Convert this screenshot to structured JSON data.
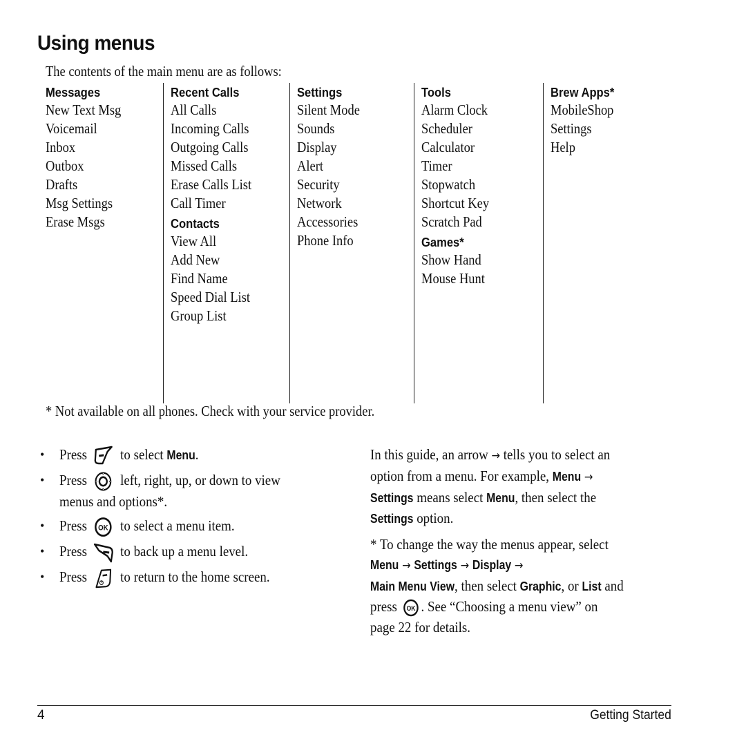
{
  "page": {
    "title": "Using menus",
    "intro": "The contents of the main menu are as follows:",
    "footnote": "* Not available on all phones. Check with your service provider.",
    "footer": {
      "page_number": "4",
      "section": "Getting Started"
    }
  },
  "menu_columns": [
    {
      "heading": "Messages",
      "items": [
        "New Text Msg",
        "Voicemail",
        "Inbox",
        "Outbox",
        "Drafts",
        "Msg Settings",
        "Erase Msgs"
      ]
    },
    {
      "heading": "Recent Calls",
      "items": [
        "All Calls",
        "Incoming Calls",
        "Outgoing Calls",
        "Missed Calls",
        "Erase Calls List",
        "Call Timer"
      ],
      "sub_heading": "Contacts",
      "sub_items": [
        "View All",
        "Add New",
        "Find Name",
        "Speed Dial List",
        "Group List"
      ]
    },
    {
      "heading": "Settings",
      "items": [
        "Silent Mode",
        "Sounds",
        "Display",
        "Alert",
        "Security",
        "Network",
        "Accessories",
        "Phone Info"
      ]
    },
    {
      "heading": "Tools",
      "items": [
        "Alarm Clock",
        "Scheduler",
        "Calculator",
        "Timer",
        "Stopwatch",
        "Shortcut Key",
        "Scratch Pad"
      ],
      "sub_heading": "Games*",
      "sub_items": [
        "Show Hand",
        "Mouse Hunt"
      ]
    },
    {
      "heading": "Brew Apps*",
      "items": [
        "MobileShop",
        "Settings",
        "Help"
      ]
    }
  ],
  "bullets": [
    {
      "bullet": "•",
      "press": "Press",
      "icon": "left-softkey-icon",
      "text_before": "to select ",
      "bold": "Menu",
      "text_after": "."
    },
    {
      "bullet": "•",
      "press": "Press",
      "icon": "navigation-key-icon",
      "text_line1": "left, right, up, or down to view",
      "text_line2": "menus and options*."
    },
    {
      "bullet": "•",
      "press": "Press",
      "icon": "ok-key-icon",
      "text": "to select a menu item."
    },
    {
      "bullet": "•",
      "press": "Press",
      "icon": "right-softkey-back-icon",
      "text": "to back up a menu level."
    },
    {
      "bullet": "•",
      "press": "Press",
      "icon": "end-power-key-icon",
      "text": "to return to the home screen."
    }
  ],
  "guide_note": {
    "p1": {
      "t1": "In this guide, an arrow ",
      "arrow": "→",
      "t2": " tells you to select an",
      "t3": "option from a menu. For example, ",
      "b1": "Menu",
      "t4": " ",
      "b2": "Settings",
      "t5": " means select ",
      "b3": "Menu",
      "t6": ", then select the",
      "b4": "Settings",
      "t7": " option."
    },
    "p2": {
      "t1": "* To change the way the menus appear, select",
      "b1": "Menu",
      "b2": "Settings",
      "b3": "Display",
      "b4": "Main Menu View",
      "t2": ", then select ",
      "b5": "Graphic",
      "t3": ", or ",
      "b6": "List",
      "t4": " and",
      "t5": "press",
      "t6": ". See “Choosing a menu view” on",
      "t7": "page 22 for details."
    },
    "arrow": "→"
  }
}
